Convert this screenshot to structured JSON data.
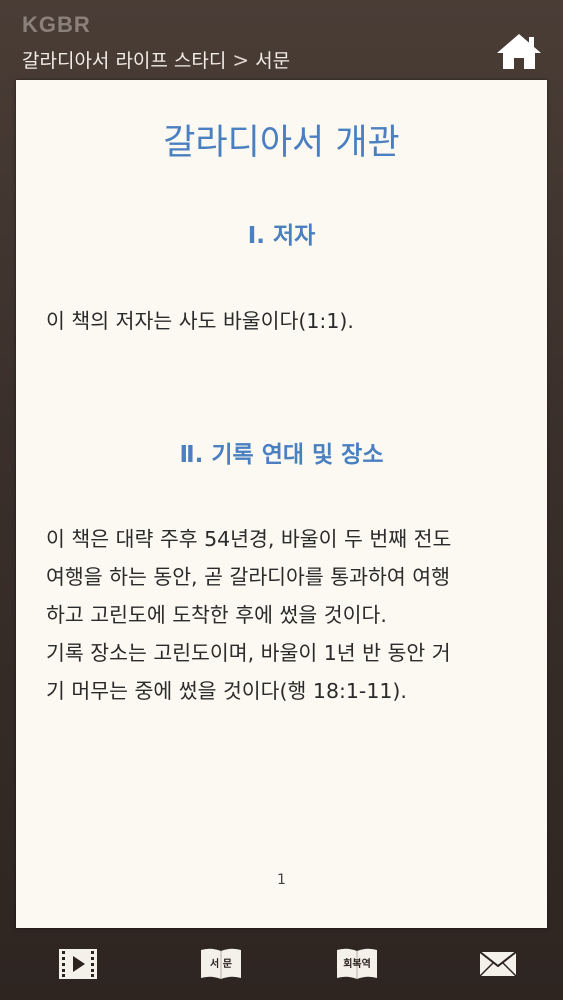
{
  "header": {
    "brand": "KGBR",
    "breadcrumb_parent": "갈라디아서 라이프 스타디",
    "breadcrumb_separator": ">",
    "breadcrumb_current": "서문",
    "home_icon": "home-icon"
  },
  "content": {
    "title": "갈라디아서 개관",
    "sections": [
      {
        "heading": "Ⅰ. 저자",
        "lines": [
          "이 책의 저자는 사도 바울이다(1:1)."
        ]
      },
      {
        "heading": "Ⅱ. 기록 연대 및 장소",
        "lines": [
          "이 책은 대략 주후 54년경, 바울이 두 번째 전도",
          "여행을 하는 동안, 곧 갈라디아를 통과하여 여행",
          "하고 고린도에 도착한 후에 썼을 것이다.",
          "기록 장소는 고린도이며, 바울이 1년 반 동안 거",
          "기 머무는 중에 썼을 것이다(행 18:1-11)."
        ]
      }
    ],
    "page_number": "1"
  },
  "bottom_nav": {
    "items": [
      {
        "icon": "play-video-icon"
      },
      {
        "icon": "book-icon",
        "label": "서 문"
      },
      {
        "icon": "book-icon",
        "label": "회복역"
      },
      {
        "icon": "mail-icon"
      }
    ]
  },
  "colors": {
    "accent": "#4a7fc1",
    "page_bg": "#fbf9f1",
    "frame_bg": "#3a2f2a"
  }
}
